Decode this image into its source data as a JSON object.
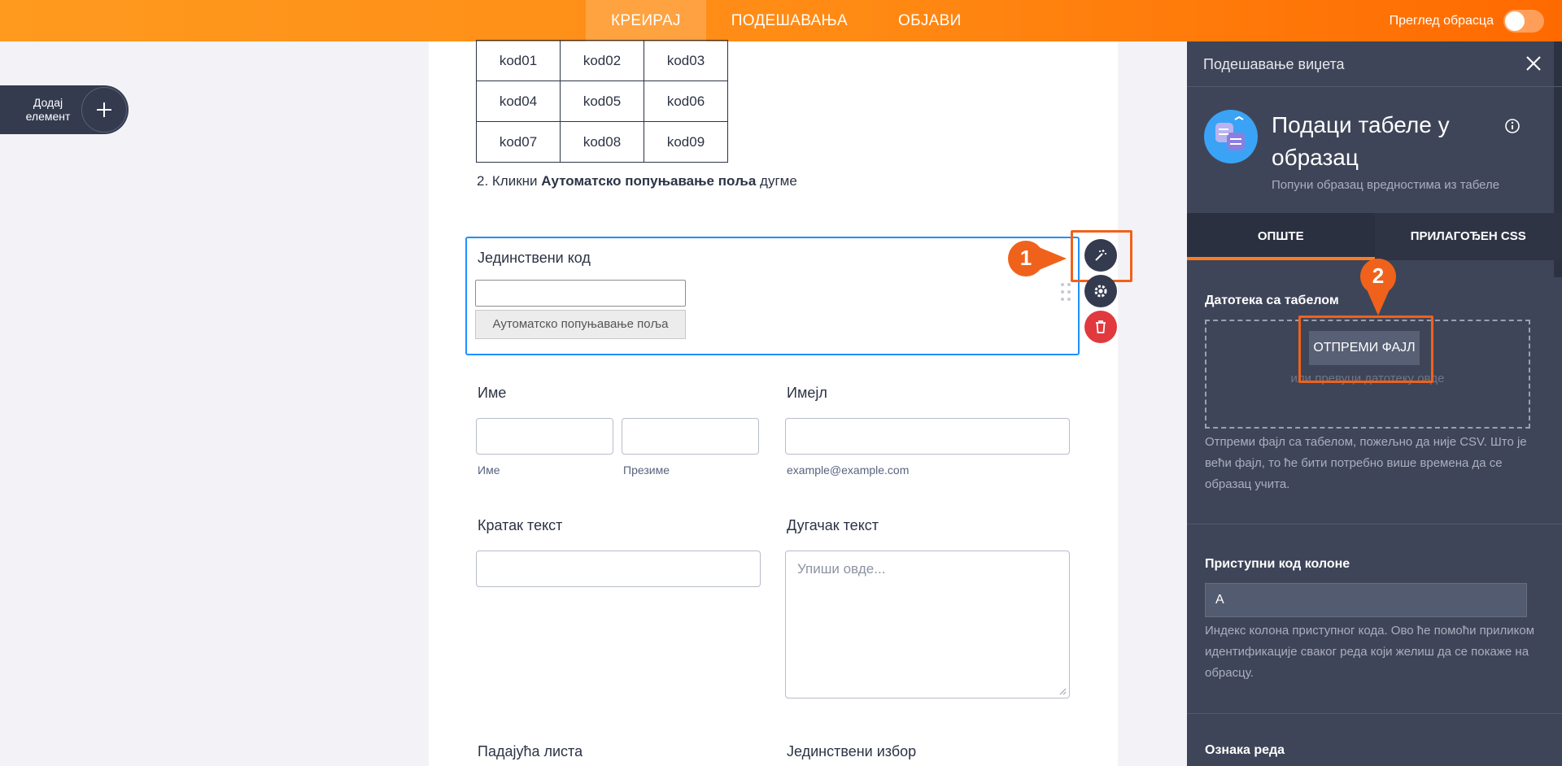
{
  "topbar": {
    "tabs": [
      "КРЕИРАЈ",
      "ПОДЕШАВАЊА",
      "ОБЈАВИ"
    ],
    "preview_label": "Преглед обрасца"
  },
  "add_element": {
    "label": "Додај елемент"
  },
  "form": {
    "codes_table": [
      [
        "kod01",
        "kod02",
        "kod03"
      ],
      [
        "kod04",
        "kod05",
        "kod06"
      ],
      [
        "kod07",
        "kod08",
        "kod09"
      ]
    ],
    "instruction_prefix": "2. Кликни ",
    "instruction_bold": "Аутоматско попуњавање поља",
    "instruction_suffix": " дугме",
    "unique_code_label": "Јединствени код",
    "autofill_button": "Аутоматско попуњавање поља",
    "name_label": "Име",
    "first_name_sublabel": "Име",
    "last_name_sublabel": "Презиме",
    "email_label": "Имејл",
    "email_sublabel": "example@example.com",
    "short_text_label": "Кратак текст",
    "long_text_label": "Дугачак текст",
    "long_text_placeholder": "Упиши овде...",
    "dropdown_label": "Падајућа листа",
    "single_choice_label": "Јединствени избор"
  },
  "annotations": {
    "step1": "1",
    "step2": "2",
    "accent": "#f0621b"
  },
  "panel": {
    "header": "Подешавање виџета",
    "widget_title": "Подаци табеле у образац",
    "widget_subtitle": "Попуни образац вредностима из табеле",
    "tabs": [
      "ОПШТЕ",
      "ПРИЛАГОЂЕН CSS"
    ],
    "file_label": "Датотека са табелом",
    "upload_button": "ОТПРЕМИ ФАЈЛ",
    "drop_hint": "или превуци датотеку овде",
    "file_help": "Отпреми фајл са табелом, пожељно да није CSV. Што је већи фајл, то ће бити потребно више времена да се образац учита.",
    "access_code_label": "Приступни код колоне",
    "access_code_value": "A",
    "access_code_help": "Индекс колона приступног кода. Ово ће помоћи приликом идентификације сваког реда који желиш да се покаже на обрасцу.",
    "row_label": "Ознака реда"
  }
}
